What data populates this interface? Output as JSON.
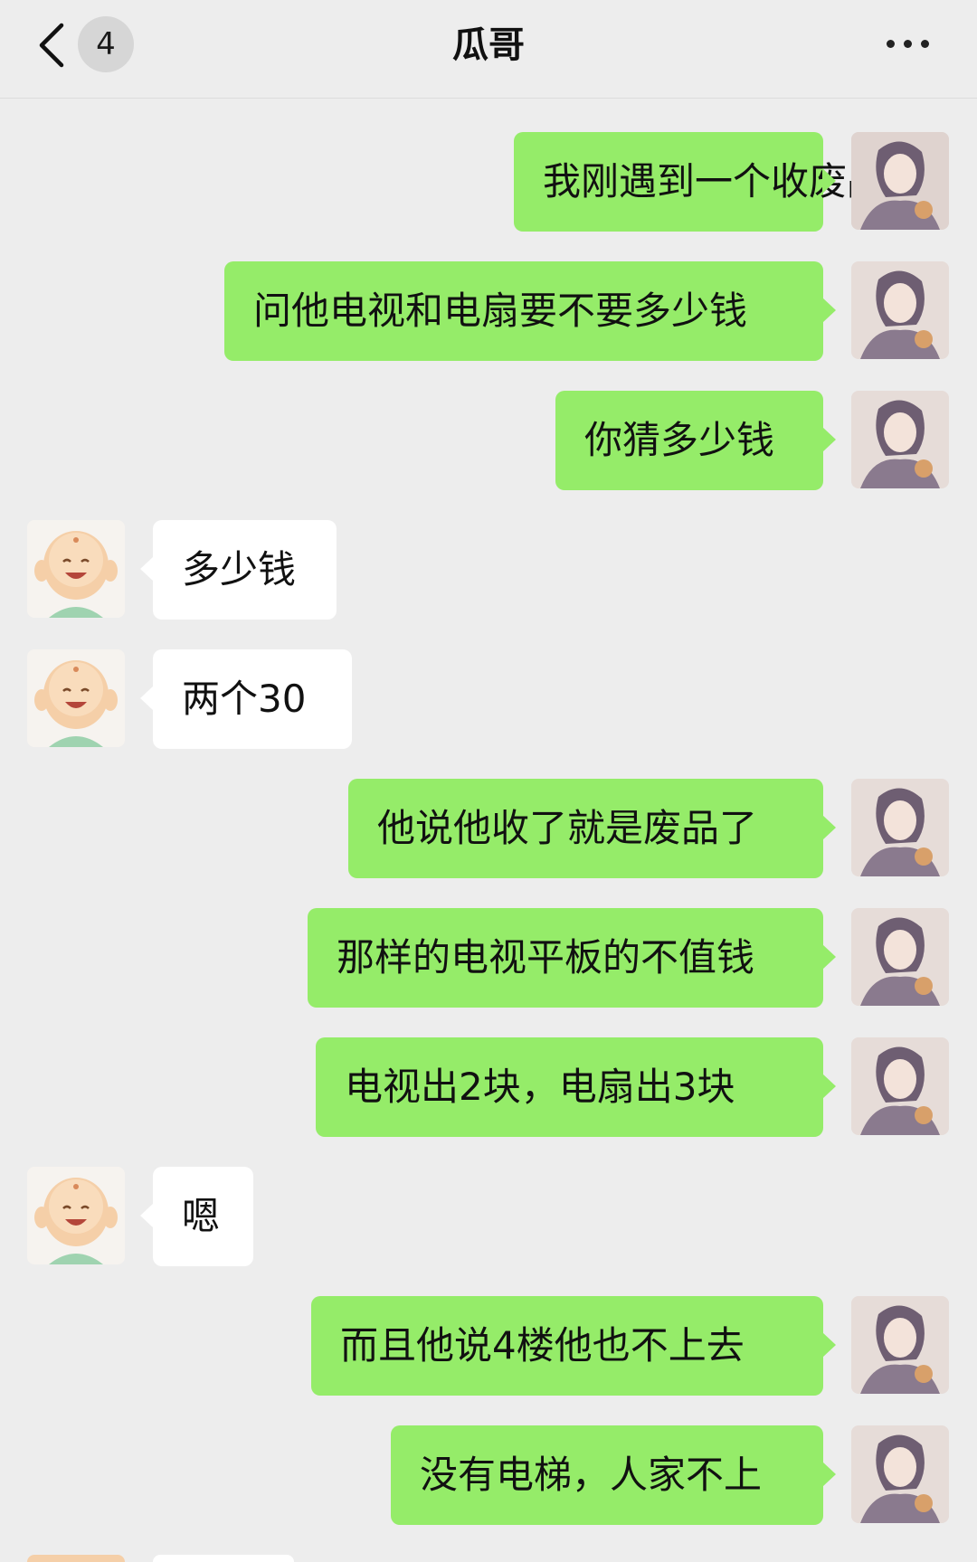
{
  "header": {
    "title": "瓜哥",
    "unread_count": "4",
    "back_icon": "chevron-left-icon",
    "more_icon": "more-dots-icon"
  },
  "messages": [
    {
      "side": "me",
      "text": "我刚遇到一个收废品的"
    },
    {
      "side": "me",
      "text": "问他电视和电扇要不要多少钱"
    },
    {
      "side": "me",
      "text": "你猜多少钱"
    },
    {
      "side": "them",
      "text": "多少钱"
    },
    {
      "side": "them",
      "text": "两个30"
    },
    {
      "side": "me",
      "text": "他说他收了就是废品了"
    },
    {
      "side": "me",
      "text": "那样的电视平板的不值钱"
    },
    {
      "side": "me",
      "text": "电视出2块，电扇出3块"
    },
    {
      "side": "them",
      "text": "嗯"
    },
    {
      "side": "me",
      "text": "而且他说4楼他也不上去"
    },
    {
      "side": "me",
      "text": "没有电梯，人家不上"
    }
  ],
  "colors": {
    "background": "#ededed",
    "my_bubble": "#95ec69",
    "their_bubble": "#ffffff"
  }
}
